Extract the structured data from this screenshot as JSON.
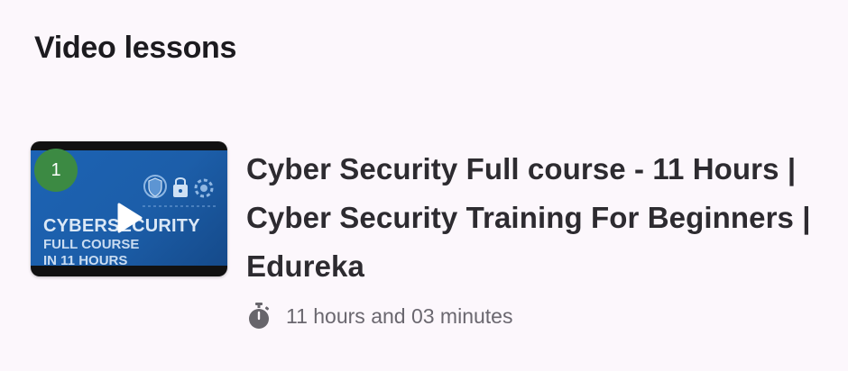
{
  "section": {
    "title": "Video lessons"
  },
  "lessons": [
    {
      "number": "1",
      "thumbnail": {
        "line1": "CYBERSECURITY",
        "line2": "FULL COURSE",
        "line3": "IN 11 HOURS"
      },
      "title": "Cyber Security Full course - 11 Hours | Cyber Security Training For Beginners | Edureka",
      "duration": "11 hours and 03 minutes",
      "duration_icon": "stopwatch-icon",
      "play_icon": "play-icon"
    }
  ],
  "colors": {
    "background": "#fcf7fc",
    "badge": "#3c8a43",
    "thumbnail_blue": "#1c63b4",
    "title_text": "#2d2b30",
    "secondary_text": "#6a676f"
  }
}
